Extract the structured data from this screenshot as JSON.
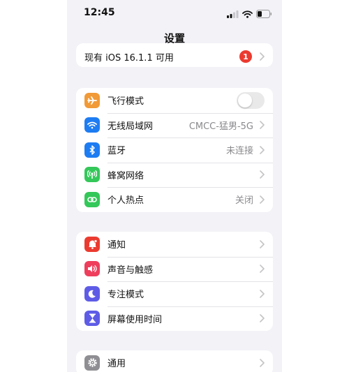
{
  "status_bar": {
    "time": "12:45"
  },
  "nav": {
    "title": "设置"
  },
  "update_row": {
    "label": "现有 iOS 16.1.1 可用",
    "badge": "1"
  },
  "groups": [
    {
      "items": [
        {
          "label": "飞行模式",
          "icon": "airplane-icon",
          "color": "#f19a37",
          "toggle": false
        },
        {
          "label": "无线局域网",
          "icon": "wifi-icon",
          "color": "#1e7cf2",
          "value": "CMCC-猛男-5G"
        },
        {
          "label": "蓝牙",
          "icon": "bluetooth-icon",
          "color": "#1e7cf2",
          "value": "未连接"
        },
        {
          "label": "蜂窝网络",
          "icon": "antenna-icon",
          "color": "#34c759"
        },
        {
          "label": "个人热点",
          "icon": "hotspot-icon",
          "color": "#34c759",
          "value": "关闭"
        }
      ]
    },
    {
      "items": [
        {
          "label": "通知",
          "icon": "bell-icon",
          "color": "#eb3b30"
        },
        {
          "label": "声音与触感",
          "icon": "speaker-icon",
          "color": "#ee3e5c"
        },
        {
          "label": "专注模式",
          "icon": "moon-icon",
          "color": "#5e5ce6"
        },
        {
          "label": "屏幕使用时间",
          "icon": "hourglass-icon",
          "color": "#5e5ce6"
        }
      ]
    },
    {
      "items": [
        {
          "label": "通用",
          "icon": "gear-icon",
          "color": "#8e8e93"
        }
      ]
    }
  ]
}
